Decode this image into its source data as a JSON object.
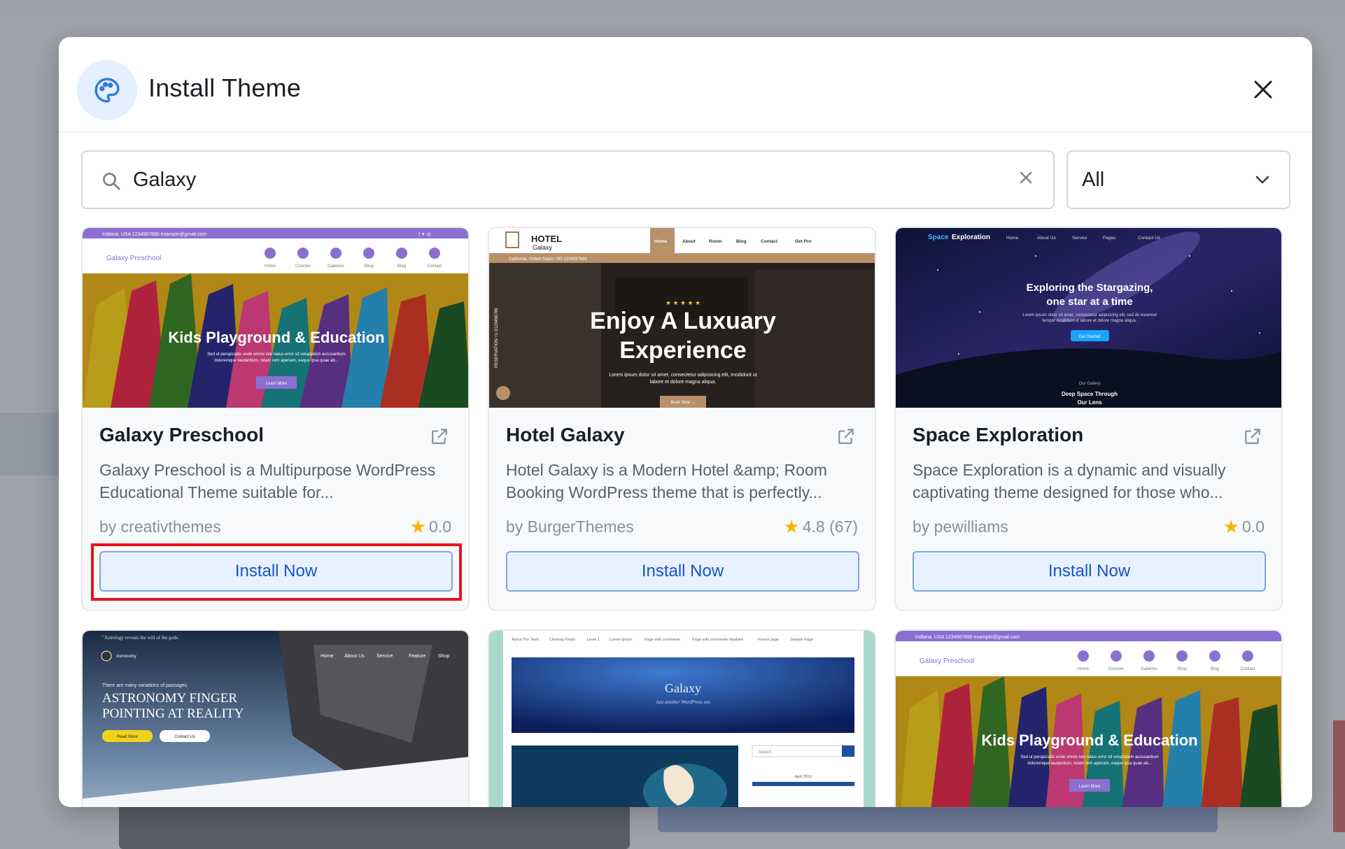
{
  "modal": {
    "title": "Install Theme",
    "header_icon": "palette-icon",
    "close_icon": "close-icon"
  },
  "search": {
    "value": "Galaxy",
    "placeholder": "Search themes"
  },
  "filter": {
    "selected": "All"
  },
  "colors": {
    "accent": "#1553c8",
    "button_bg": "#e8f1ff",
    "star": "#f5b400",
    "highlight": "#e4141a"
  },
  "themes": [
    {
      "title": "Galaxy Preschool",
      "description": "Galaxy Preschool is a Multipurpose WordPress Educational Theme suitable for...",
      "author": "by creativthemes",
      "rating": "0.0",
      "button": "Install Now",
      "preview": {
        "brand": "Galaxy Preschool",
        "topbar": "Indiana, USA   1234567890   example@gmail.com",
        "nav": [
          "Home",
          "Courses",
          "Galleries",
          "Shop",
          "Blog",
          "Contact"
        ],
        "headline": "Kids Playground & Education",
        "sub": "Sed ut perspiciatis unde omnis iste natus error sit voluptatem accusantium doloremque laudantium, totam rem aperiam, eaque ipsa quae ab...",
        "cta": "Learn More"
      }
    },
    {
      "title": "Hotel Galaxy",
      "description": "Hotel Galaxy is a Modern Hotel &amp; Room Booking WordPress theme that is perfectly...",
      "author": "by BurgerThemes",
      "rating": "4.8 (67)",
      "button": "Install Now",
      "preview": {
        "brand": "HOTEL",
        "brand_sub": "Galaxy",
        "nav": [
          "Home",
          "About",
          "Room",
          "Blog",
          "Contact",
          "Get Pro"
        ],
        "topbar": "California, United States   +00-1234567890",
        "stars": "★ ★ ★ ★ ★",
        "headline": "Enjoy A Luxuary Experience",
        "sub": "Lorem ipsum dolor sit amet, consectetur adipisicing elit, incididunt ut labore et dolore magna aliqua.",
        "cta": "Book Now →",
        "side": "RESERVATION +1 0123456789"
      }
    },
    {
      "title": "Space Exploration",
      "description": "Space Exploration is a dynamic and visually captivating theme designed for those who...",
      "author": "by pewilliams",
      "rating": "0.0",
      "button": "Install Now",
      "preview": {
        "brand_a": "Space",
        "brand_b": "Exploration",
        "nav": [
          "Home",
          "About Us",
          "Service",
          "Pages",
          "Contact Us"
        ],
        "headline": "Exploring the Stargazing, one star at a time",
        "sub": "Lorem ipsum dolor sit amet, consectetur adipisicing elit, sed do eiusmod tempor incididunt ut labore et dolore magna aliqua.",
        "cta": "Get Started",
        "gallery_label": "Our Gallery",
        "gallery_title": "Deep Space Through Our Lens"
      }
    },
    {
      "preview": {
        "quote": "\"Astrology reveals the will of the gods.",
        "brand": "Astronomy",
        "nav": [
          "Home",
          "About Us",
          "Service",
          "Feature",
          "Shop"
        ],
        "kicker": "There are many variations of passages.",
        "headline": "ASTRONOMY FINGER POINTING AT REALITY",
        "cta_primary": "Read More",
        "cta_secondary": "Contact Us"
      }
    },
    {
      "preview": {
        "topnav": [
          "About The Tests",
          "Clearing Floats",
          "Level 1",
          "Lorem Ipsum",
          "Page with comments",
          "Page with comments disabled",
          "Parent page",
          "Sample Page"
        ],
        "headline": "Galaxy",
        "sub": "Just another WordPress site",
        "search": "Search",
        "calendar": "April 2012"
      }
    },
    {
      "preview": {
        "brand": "Galaxy Preschool",
        "topbar": "Indiana, USA   1234567890   example@gmail.com",
        "nav": [
          "Home",
          "Courses",
          "Galleries",
          "Shop",
          "Blog",
          "Contact"
        ],
        "headline": "Kids Playground & Education",
        "sub": "Sed ut perspiciatis unde omnis iste natus error sit voluptatem accusantium doloremque laudantium, totam rem aperiam, eaque ipsa quae ab...",
        "cta": "Learn More"
      }
    }
  ]
}
